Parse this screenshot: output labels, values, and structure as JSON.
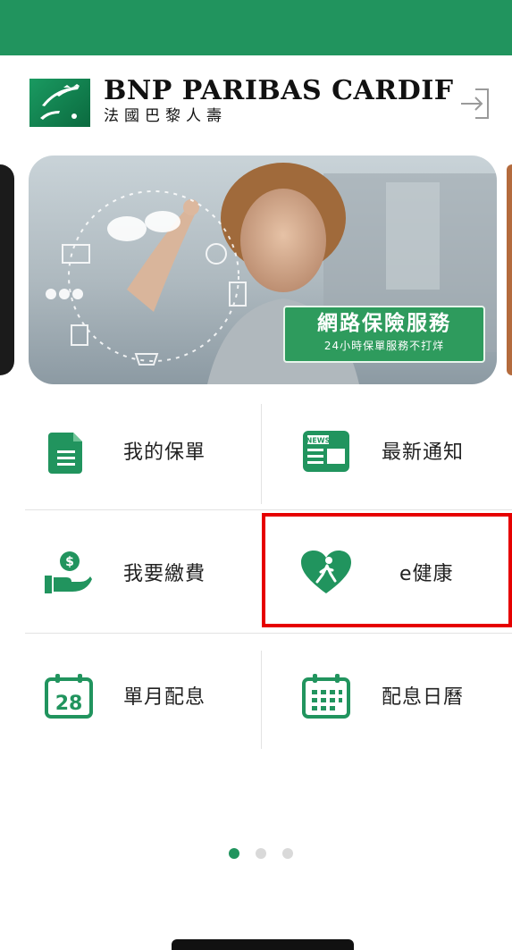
{
  "brand": {
    "name_en": "BNP PARIBAS CARDIF",
    "name_zh": "法國巴黎人壽"
  },
  "banner": {
    "title": "網路保險服務",
    "subtitle": "24小時保單服務不打烊"
  },
  "menu": [
    {
      "label": "我的保單",
      "icon": "document-icon"
    },
    {
      "label": "最新通知",
      "icon": "news-icon"
    },
    {
      "label": "我要繳費",
      "icon": "payment-hand-icon"
    },
    {
      "label": "e健康",
      "icon": "heart-walker-icon"
    },
    {
      "label": "單月配息",
      "icon": "calendar-28-icon"
    },
    {
      "label": "配息日曆",
      "icon": "calendar-grid-icon"
    }
  ],
  "pager": {
    "pages": 3,
    "active": 1
  },
  "colors": {
    "brand_green": "#21945e",
    "highlight_red": "#e60000"
  }
}
